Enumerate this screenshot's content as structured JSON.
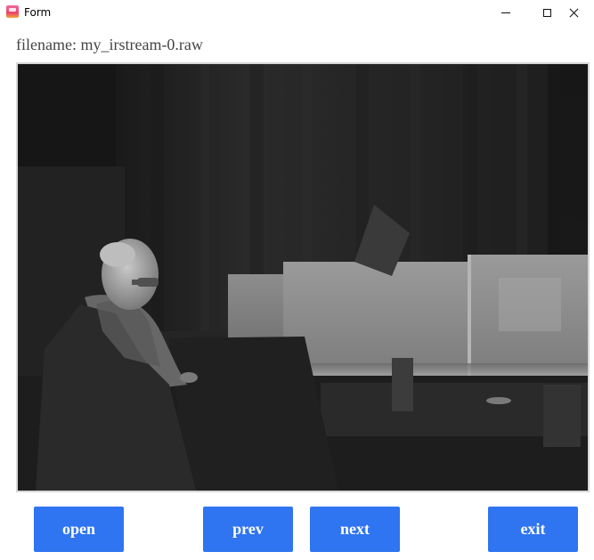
{
  "window": {
    "title": "Form",
    "controls": {
      "minimize_icon": "minimize-icon",
      "maximize_icon": "maximize-icon",
      "close_icon": "close-icon"
    }
  },
  "file": {
    "label_prefix": "filename:",
    "name": "my_irstream-0.raw",
    "full_text": "filename: my_irstream-0.raw"
  },
  "image_view": {
    "content": "infrared-frame",
    "palette": "grayscale"
  },
  "buttons": {
    "open": "open",
    "prev": "prev",
    "next": "next",
    "exit": "exit"
  },
  "colors": {
    "button_bg": "#2f74f0",
    "button_text": "#ffffff",
    "label_text": "#444444"
  }
}
